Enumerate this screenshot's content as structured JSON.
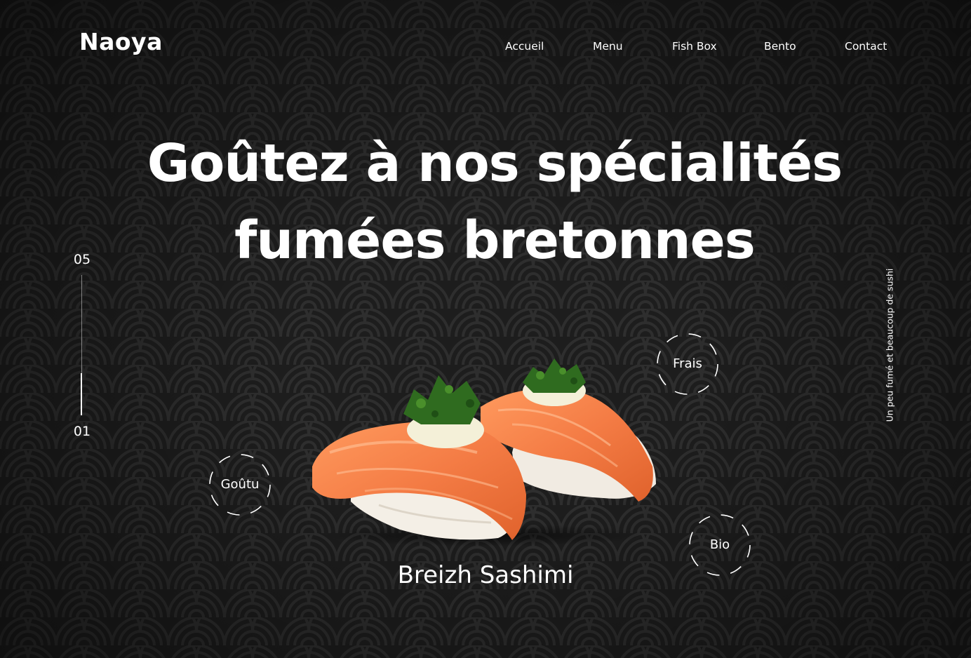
{
  "brand": {
    "name": "Naoya"
  },
  "nav": {
    "items": [
      {
        "label": "Accueil"
      },
      {
        "label": "Menu"
      },
      {
        "label": "Fish Box"
      },
      {
        "label": "Bento"
      },
      {
        "label": "Contact"
      }
    ]
  },
  "hero": {
    "headline_line1": "Goûtez à nos spécialités",
    "headline_line2": "fumées bretonnes",
    "product_name": "Breizh Sashimi",
    "side_text": "Un peu fumé et beaucoup de sushi"
  },
  "slider": {
    "total": "05",
    "current": "01"
  },
  "badges": [
    {
      "label": "Frais"
    },
    {
      "label": "Goûtu"
    },
    {
      "label": "Bio"
    }
  ],
  "colors": {
    "background": "#1d1d1d",
    "pattern_stroke": "#2e2e2e",
    "text": "#ffffff",
    "salmon": "#f47c45"
  }
}
